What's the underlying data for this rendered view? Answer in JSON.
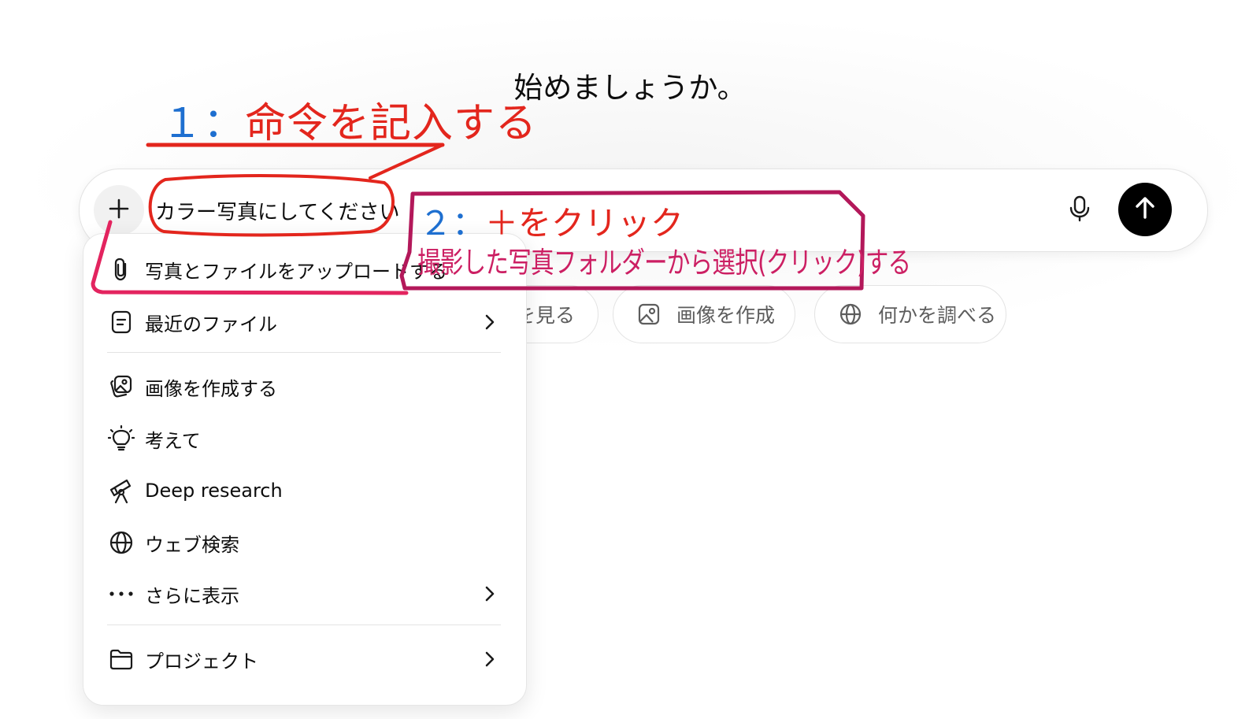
{
  "header": {
    "title": "始めましょうか。"
  },
  "composer": {
    "input_value": "カラー写真にしてください"
  },
  "chips": [
    {
      "label": "を見る",
      "icon": "eye-icon"
    },
    {
      "label": "画像を作成",
      "icon": "image-icon"
    },
    {
      "label": "何かを調べる",
      "icon": "globe-icon"
    }
  ],
  "menu": {
    "items": [
      {
        "label": "写真とファイルをアップロードする",
        "icon": "paperclip-icon",
        "has_submenu": false
      },
      {
        "label": "最近のファイル",
        "icon": "file-icon",
        "has_submenu": true
      },
      {
        "label": "画像を作成する",
        "icon": "image-sparkle-icon",
        "has_submenu": false
      },
      {
        "label": "考えて",
        "icon": "lightbulb-icon",
        "has_submenu": false
      },
      {
        "label": "Deep research",
        "icon": "telescope-icon",
        "has_submenu": false
      },
      {
        "label": "ウェブ検索",
        "icon": "globe-icon",
        "has_submenu": false
      },
      {
        "label": "さらに表示",
        "icon": "ellipsis-icon",
        "has_submenu": true
      },
      {
        "label": "プロジェクト",
        "icon": "folder-icon",
        "has_submenu": true
      }
    ]
  },
  "annotations": {
    "step1_number": "１：",
    "step1_text": "命令を記入する",
    "step2_number": "２：",
    "step2_text": "＋をクリック",
    "step2_desc": "撮影した写真フォルダーから選択(クリック)する",
    "colors": {
      "red": "#e3261d",
      "blue": "#1e6fd0",
      "magenta": "#cc1f63"
    }
  }
}
